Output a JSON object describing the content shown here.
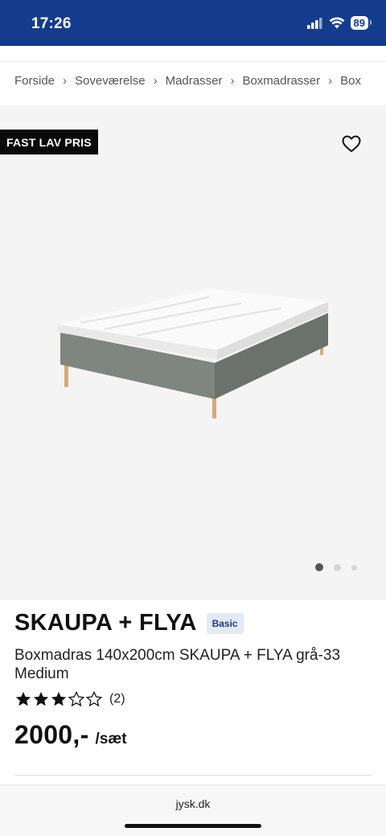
{
  "status_bar": {
    "time": "17:26",
    "battery": "89"
  },
  "breadcrumb": [
    "Forside",
    "Soveværelse",
    "Madrasser",
    "Boxmadrasser",
    "Box"
  ],
  "gallery": {
    "badge": "FAST LAV PRIS",
    "image_count": 3,
    "active_index": 0
  },
  "product": {
    "name": "SKAUPA + FLYA",
    "tag": "Basic",
    "subtitle": "Boxmadras 140x200cm SKAUPA + FLYA grå-33 Medium",
    "rating": 3,
    "rating_max": 5,
    "review_count": "(2)",
    "price": "2000,-",
    "unit": "/sæt"
  },
  "browser": {
    "url": "jysk.dk"
  },
  "colors": {
    "brand": "#143c8c",
    "badge_bg": "#0a0a0a",
    "image_bg": "#f4f4f4"
  },
  "icons": [
    "signal-icon",
    "wifi-icon",
    "battery-icon",
    "heart-icon",
    "chevron-right-icon",
    "star-icon"
  ]
}
